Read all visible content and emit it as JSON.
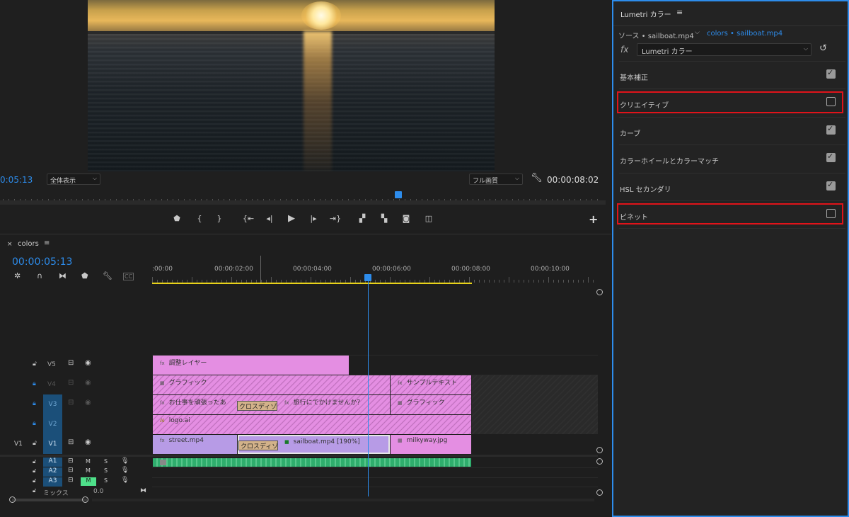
{
  "monitor": {
    "timecode_left": "0:05:13",
    "zoom_label": "全体表示",
    "quality_label": "フル画質",
    "timecode_right": "00:00:08:02",
    "add_label": "+"
  },
  "timeline": {
    "tab_label": "colors",
    "close_label": "×",
    "playhead_timecode": "00:00:05:13",
    "ruler_labels": [
      ":00:00",
      "00:00:02:00",
      "00:00:04:00",
      "00:00:06:00",
      "00:00:08:00",
      "00:00:10:00"
    ],
    "tracks": {
      "v5": "V5",
      "v4": "V4",
      "v3": "V3",
      "v2": "V2",
      "v1": "V1",
      "v1_source": "V1",
      "a1": "A1",
      "a2": "A2",
      "a3": "A3",
      "mix": "ミックス",
      "mix_value": "0.0",
      "m": "M",
      "s": "S"
    },
    "clips": {
      "adjust": "調整レイヤー",
      "graphic1": "グラフィック",
      "sample_text": "サンプルテキスト",
      "oshigoto": "お仕事を頑張ったあ",
      "cross1": "クロスディゾ",
      "ryokou": "旅行にでかけませんか？",
      "graphic2": "グラフィック",
      "logo": "logo.ai",
      "street": "street.mp4",
      "cross2": "クロスディゾ",
      "sailboat": "sailboat.mp4 [190%]",
      "milkyway": "milkyway.jpg"
    }
  },
  "lumetri": {
    "title": "Lumetri カラー",
    "menu_icon": "≡",
    "source_label": "ソース • sailboat.mp4",
    "sequence_label": "colors • sailboat.mp4",
    "fx_label": "fx",
    "effect_label": "Lumetri カラー",
    "sections": [
      {
        "label": "基本補正",
        "checked": true
      },
      {
        "label": "クリエイティブ",
        "checked": false
      },
      {
        "label": "カーブ",
        "checked": true
      },
      {
        "label": "カラーホイールとカラーマッチ",
        "checked": true
      },
      {
        "label": "HSL セカンダリ",
        "checked": true
      },
      {
        "label": "ビネット",
        "checked": false
      }
    ]
  },
  "colors": {
    "accent_blue": "#2d8ceb",
    "highlight_red": "#e0131a",
    "clip_pink": "#e48ee2",
    "clip_purple": "#b79be6",
    "audio_green": "#2fae6d",
    "work_area_yellow": "#e8d21a"
  }
}
